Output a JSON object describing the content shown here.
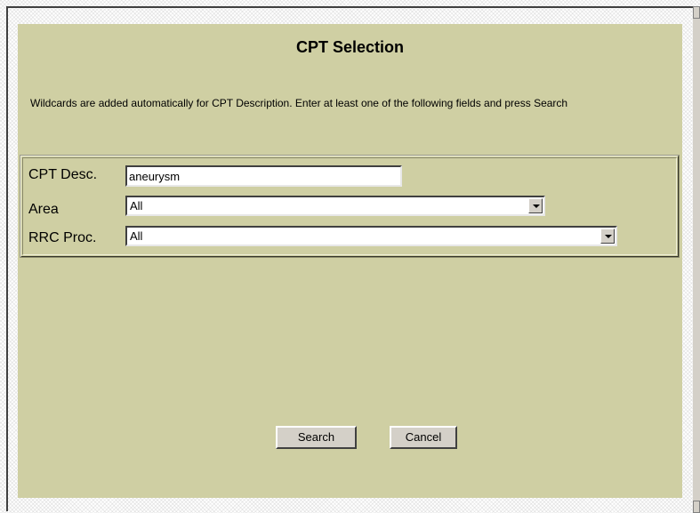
{
  "dialog": {
    "title": "CPT Selection",
    "instructions": "Wildcards are added automatically for CPT Description. Enter at least one of the following fields and press Search"
  },
  "form": {
    "cpt_desc_label": "CPT Desc.",
    "cpt_desc_value": "aneurysm",
    "area_label": "Area",
    "area_value": "All",
    "rrc_label": "RRC Proc.",
    "rrc_value": "All"
  },
  "buttons": {
    "search_label": "Search",
    "cancel_label": "Cancel"
  },
  "colors": {
    "panel_bg": "#cfcfa3",
    "button_bg": "#d4d0c8"
  },
  "icons": [
    "dropdown-arrow-icon",
    "scroll-up-icon",
    "scroll-down-icon",
    "text-cursor-icon"
  ]
}
